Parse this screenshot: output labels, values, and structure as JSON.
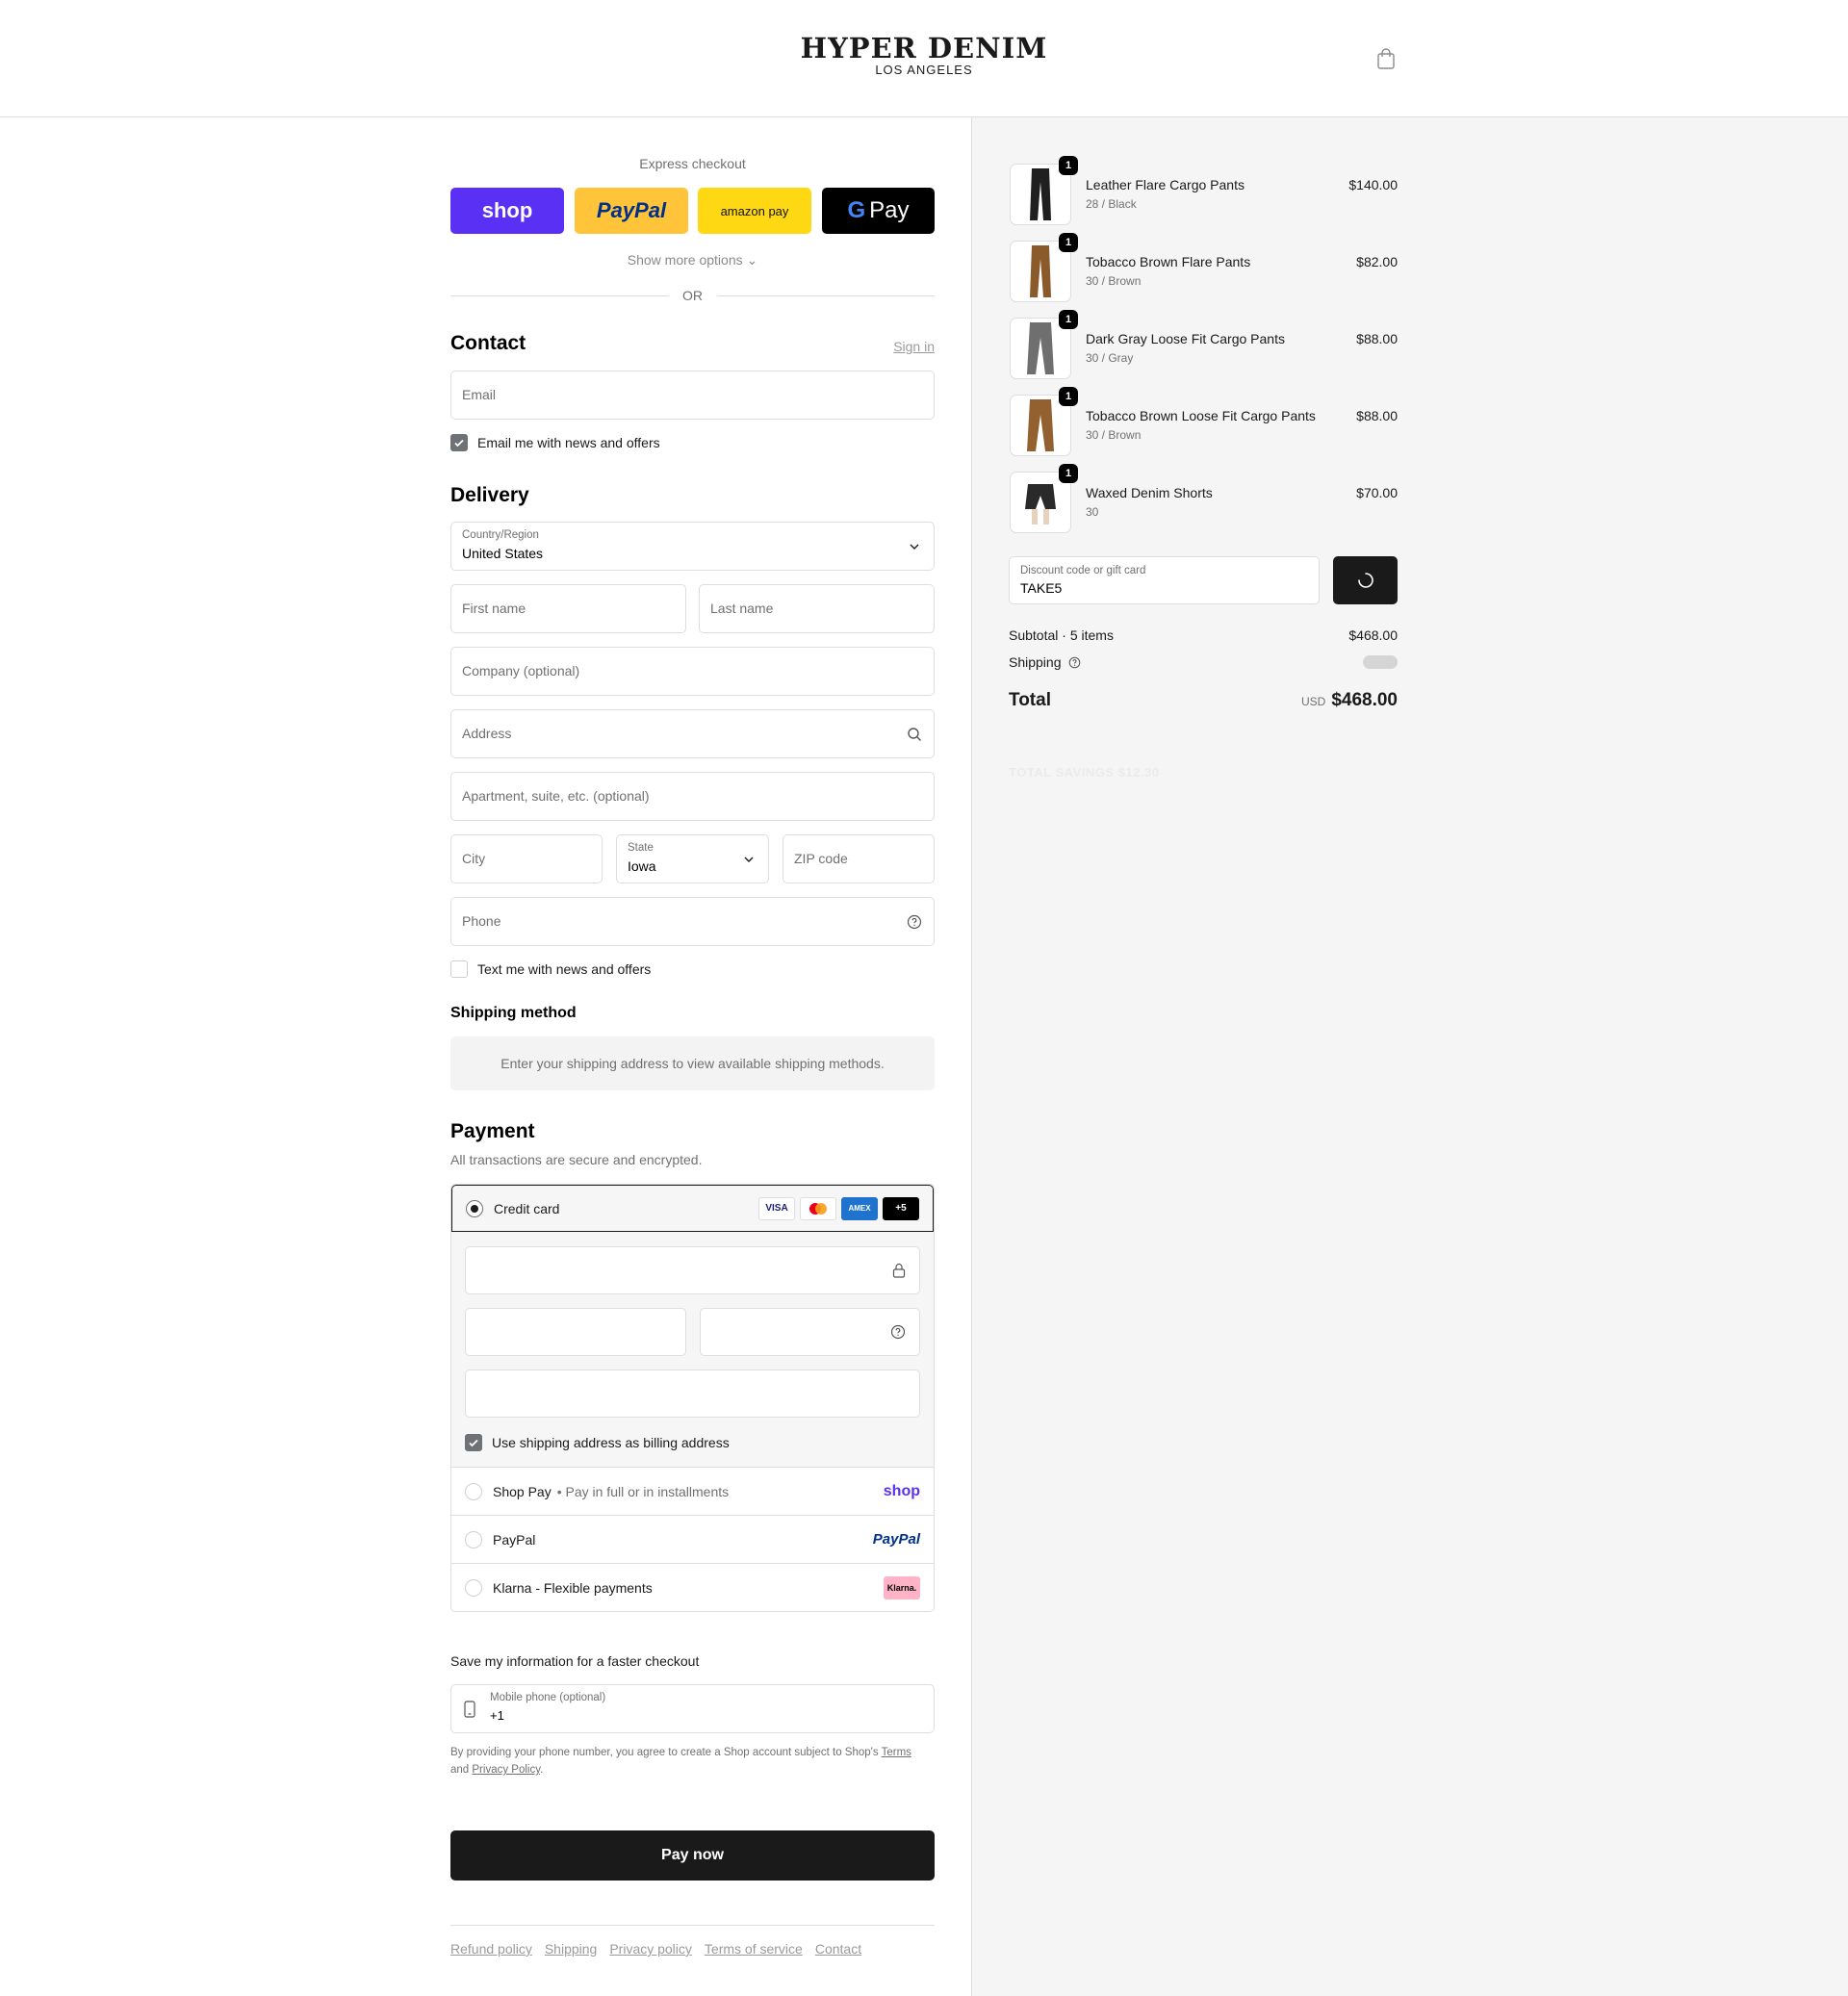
{
  "header": {
    "logo_main": "HYPER DENIM",
    "logo_sub": "LOS ANGELES",
    "cart_icon": "shopping-bag-icon"
  },
  "express": {
    "label": "Express checkout",
    "shop_label": "shop",
    "paypal_label": "PayPal",
    "amazon_label": "amazon pay",
    "gpay_g": "G",
    "gpay_label": "Pay",
    "show_more": "Show more options ⌄",
    "or": "OR"
  },
  "contact": {
    "title": "Contact",
    "sign_in": "Sign in",
    "email_placeholder": "Email",
    "news_checkbox": "Email me with news and offers",
    "news_checked": true
  },
  "delivery": {
    "title": "Delivery",
    "country_label": "Country/Region",
    "country_value": "United States",
    "first_name": "First name",
    "last_name": "Last name",
    "company": "Company (optional)",
    "address": "Address",
    "apartment": "Apartment, suite, etc. (optional)",
    "city": "City",
    "state_label": "State",
    "state_value": "Iowa",
    "zip": "ZIP code",
    "phone": "Phone",
    "text_checkbox": "Text me with news and offers",
    "text_checked": false
  },
  "shipping_method": {
    "title": "Shipping method",
    "message": "Enter your shipping address to view available shipping methods."
  },
  "payment": {
    "title": "Payment",
    "subtitle": "All transactions are secure and encrypted.",
    "credit_card": "Credit card",
    "card_brands": [
      "VISA",
      "●●",
      "AMEX",
      "+5"
    ],
    "billing_checkbox": "Use shipping address as billing address",
    "billing_checked": true,
    "shop_pay": "Shop Pay",
    "shop_pay_sub": "• Pay in full or in installments",
    "shop_pay_logo": "shop",
    "paypal": "PayPal",
    "paypal_logo": "PayPal",
    "klarna": "Klarna - Flexible payments",
    "klarna_logo": "Klarna."
  },
  "save_info": {
    "title": "Save my information for a faster checkout",
    "mobile_label": "Mobile phone (optional)",
    "mobile_value": "+1",
    "policy_prefix": "By providing your phone number, you agree to create a Shop account subject to Shop's",
    "terms": "Terms",
    "and": "and",
    "privacy": "Privacy Policy",
    "period": "."
  },
  "pay_now": "Pay now",
  "footer_links": [
    "Refund policy",
    "Shipping",
    "Privacy policy",
    "Terms of service",
    "Contact"
  ],
  "order": {
    "items": [
      {
        "qty": "1",
        "name": "Leather Flare Cargo Pants",
        "variant": "28 / Black",
        "price": "$140.00",
        "color": "#1f1f1f"
      },
      {
        "qty": "1",
        "name": "Tobacco Brown Flare Pants",
        "variant": "30 / Brown",
        "price": "$82.00",
        "color": "#8a5a2b"
      },
      {
        "qty": "1",
        "name": "Dark Gray Loose Fit Cargo Pants",
        "variant": "30 / Gray",
        "price": "$88.00",
        "color": "#6f6f6f"
      },
      {
        "qty": "1",
        "name": "Tobacco Brown Loose Fit Cargo Pants",
        "variant": "30 / Brown",
        "price": "$88.00",
        "color": "#93602f"
      },
      {
        "qty": "1",
        "name": "Waxed Denim Shorts",
        "variant": "30",
        "price": "$70.00",
        "color": "#2a2a2a"
      }
    ],
    "discount_label": "Discount code or gift card",
    "discount_value": "TAKE5",
    "subtotal_label": "Subtotal · 5 items",
    "subtotal_value": "$468.00",
    "shipping_label": "Shipping",
    "total_label": "Total",
    "currency": "USD",
    "total_value": "$468.00",
    "savings_ghost": "TOTAL SAVINGS $12.30"
  }
}
